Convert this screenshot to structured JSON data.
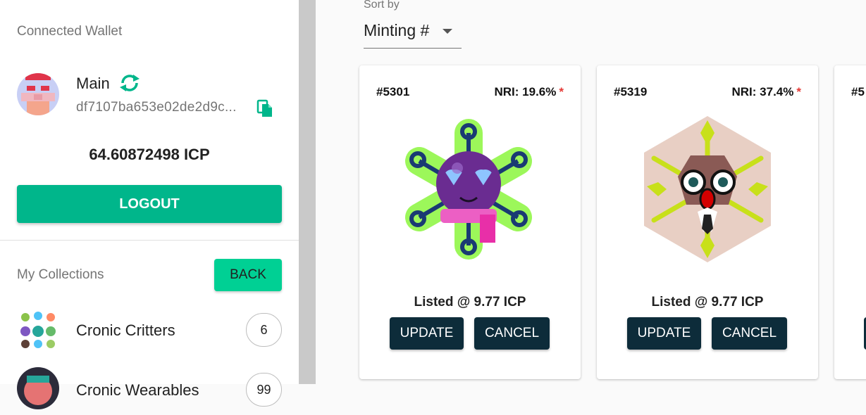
{
  "wallet": {
    "section_title": "Connected Wallet",
    "name": "Main",
    "address": "df7107ba653e02de2d9c...",
    "balance": "64.60872498 ICP",
    "logout_label": "LOGOUT"
  },
  "collections": {
    "section_title": "My Collections",
    "back_label": "BACK",
    "items": [
      {
        "name": "Cronic Critters",
        "count": "6"
      },
      {
        "name": "Cronic Wearables",
        "count": "99"
      }
    ]
  },
  "sort": {
    "label": "Sort by",
    "value": "Minting #"
  },
  "cards": [
    {
      "id": "#5301",
      "nri": "NRI: 19.6%",
      "star": "*",
      "listed": "Listed @ 9.77 ICP",
      "update_label": "UPDATE",
      "cancel_label": "CANCEL"
    },
    {
      "id": "#5319",
      "nri": "NRI: 37.4%",
      "star": "*",
      "listed": "Listed @ 9.77 ICP",
      "update_label": "UPDATE",
      "cancel_label": "CANCEL"
    },
    {
      "id": "#5"
    }
  ],
  "colors": {
    "primary_green": "#00b68b",
    "back_green": "#00d094",
    "dark_button": "#0d2c3a",
    "star_red": "#e53935"
  },
  "icons": {
    "refresh": "refresh-icon",
    "copy": "copy-icon",
    "dropdown": "caret-down-icon"
  }
}
